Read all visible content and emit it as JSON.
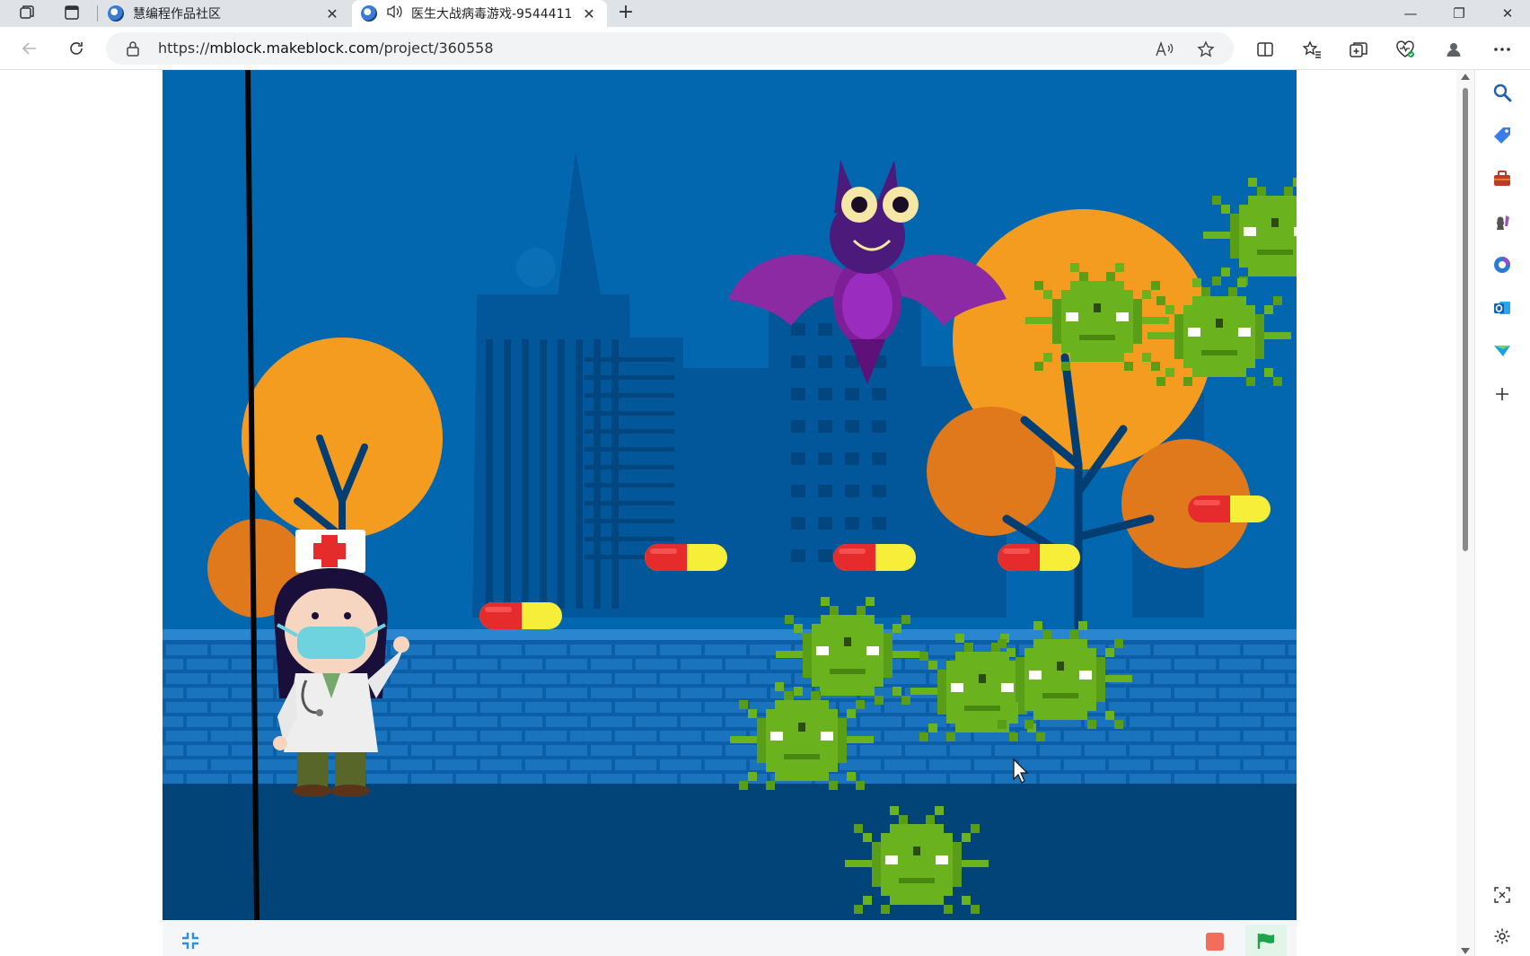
{
  "browser": {
    "tabs": [
      {
        "title": "慧编程作品社区",
        "active": false
      },
      {
        "title": "医生大战病毒游戏-9544411",
        "active": true
      }
    ],
    "new_tab_glyph": "+",
    "close_glyph": "✕",
    "url_scheme": "https://",
    "url_host": "mblock.makeblock.com",
    "url_path": "/project/360558",
    "window_controls": {
      "minimize": "—",
      "restore": "❐",
      "close": "✕"
    }
  },
  "icons": {
    "workspaces": "workspaces-icon",
    "tab_actions": "tab-actions-icon",
    "back": "back-arrow-icon",
    "refresh": "refresh-icon",
    "read_aloud": "read-aloud-icon",
    "favorite": "star-icon",
    "split_screen": "split-screen-icon",
    "favorites": "favorites-icon",
    "collections": "collections-icon",
    "browser_essentials": "heart-shield-icon",
    "profile": "profile-icon",
    "more": "more-icon"
  },
  "sidebar": {
    "items": [
      "search-icon",
      "shopping-tag-icon",
      "tools-icon",
      "games-icon",
      "microsoft365-icon",
      "outlook-icon",
      "send-icon",
      "add-icon"
    ],
    "bottom": [
      "screenshot-icon",
      "settings-icon"
    ]
  },
  "game": {
    "title": "医生大战病毒游戏",
    "colors": {
      "sky": "#0267ae",
      "ground": "#034478",
      "bricks": "#1a74bd",
      "stop": "#f26d5b",
      "go": "#1fa34a"
    }
  }
}
